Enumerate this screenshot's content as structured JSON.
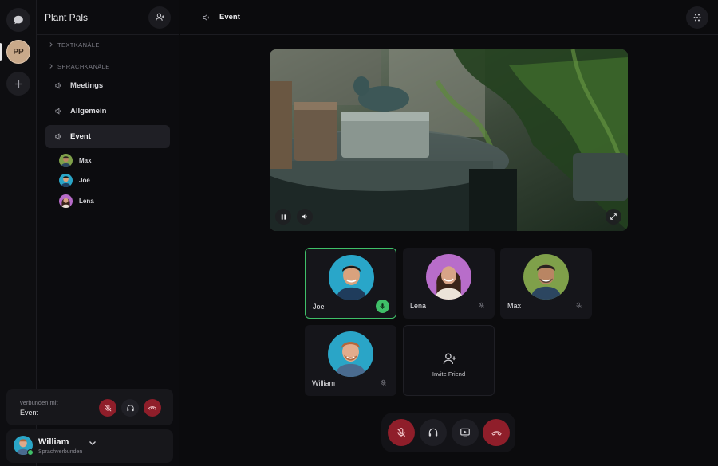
{
  "server": {
    "initials": "PP",
    "name": "Plant Pals"
  },
  "categories": {
    "text": "TEXTKANÄLE",
    "voice": "SPRACHKANÄLE"
  },
  "channels": [
    {
      "label": "Meetings",
      "active": false
    },
    {
      "label": "Allgemein",
      "active": false
    },
    {
      "label": "Event",
      "active": true
    }
  ],
  "channel_members": [
    {
      "name": "Max"
    },
    {
      "name": "Joe"
    },
    {
      "name": "Lena"
    }
  ],
  "voice_status": {
    "label": "verbunden mit",
    "channel": "Event"
  },
  "user": {
    "name": "William",
    "status": "Sprachverbunden"
  },
  "main_header": {
    "channel": "Event"
  },
  "participants": [
    {
      "name": "Joe",
      "speaking": true,
      "muted": false
    },
    {
      "name": "Lena",
      "speaking": false,
      "muted": true
    },
    {
      "name": "Max",
      "speaking": false,
      "muted": true
    },
    {
      "name": "William",
      "speaking": false,
      "muted": true
    }
  ],
  "invite": {
    "label": "Invite Friend"
  },
  "colors": {
    "speaking": "#3fbf68",
    "danger": "#8f1e2a",
    "surface": "#15151a",
    "background": "#0b0b0d"
  }
}
